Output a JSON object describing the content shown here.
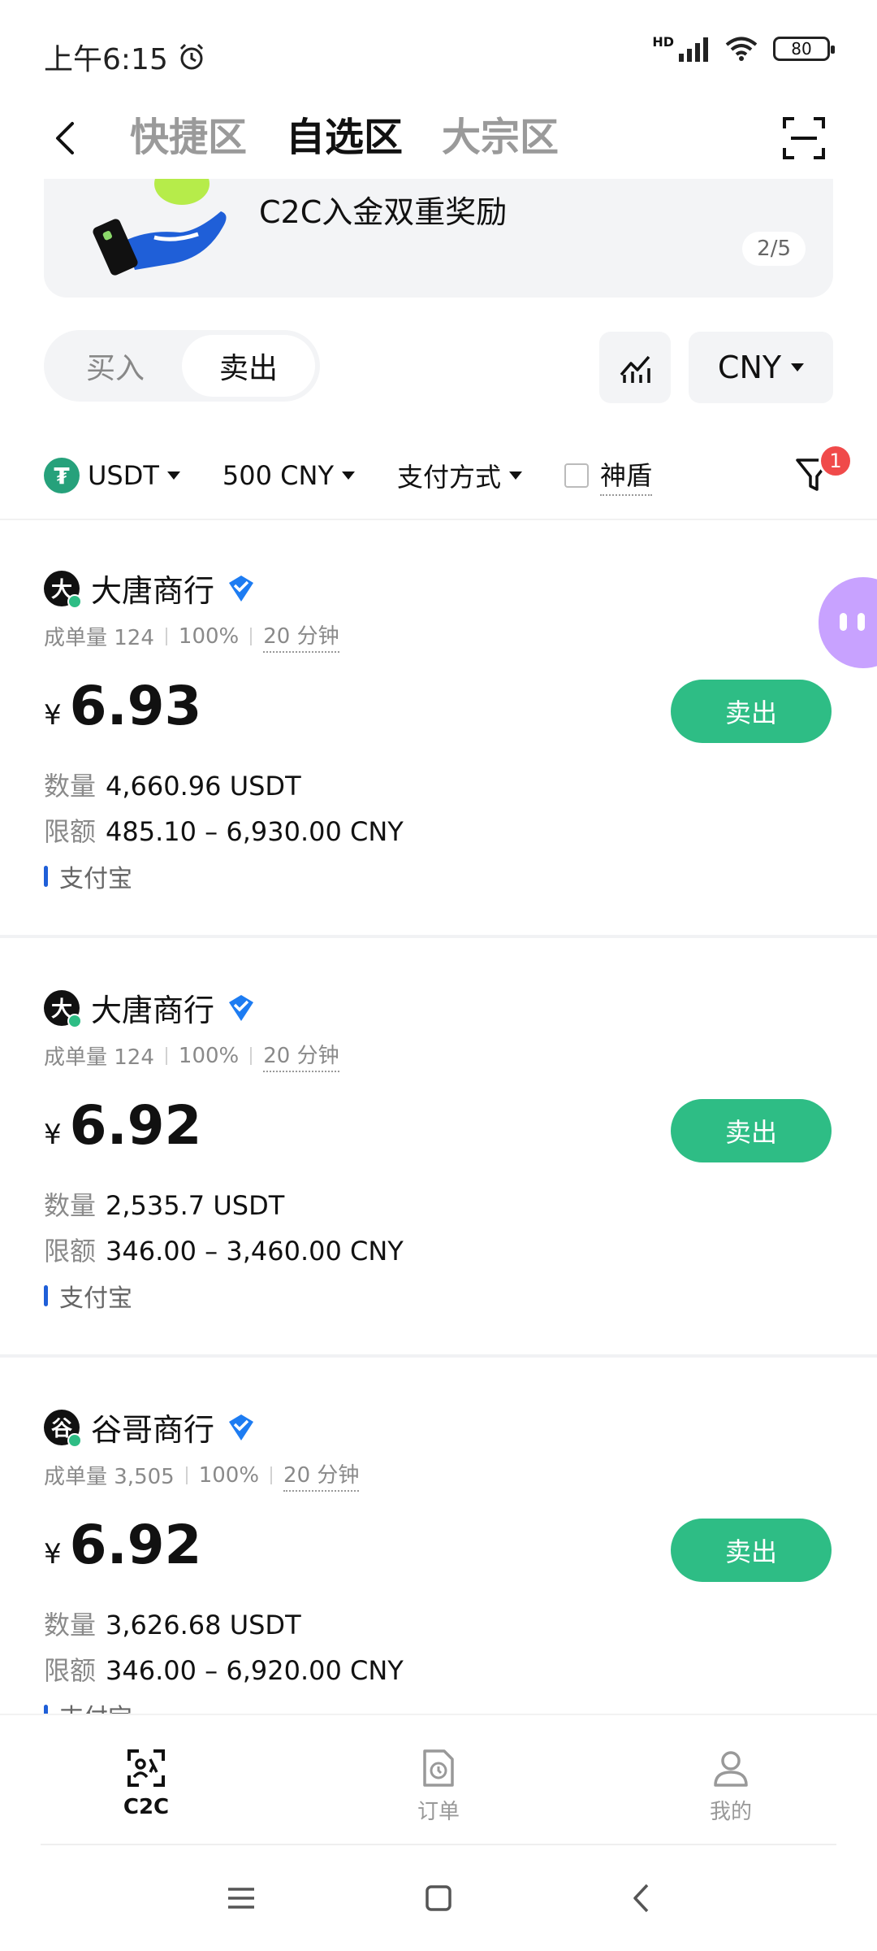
{
  "status_bar": {
    "time": "上午6:15",
    "network": "HD",
    "battery": "80"
  },
  "header": {
    "tabs": [
      {
        "label": "快捷区",
        "active": false
      },
      {
        "label": "自选区",
        "active": true
      },
      {
        "label": "大宗区",
        "active": false
      }
    ]
  },
  "banner": {
    "text": "C2C入金双重奖励",
    "page": "2/5"
  },
  "trade_toggle": {
    "buy_label": "买入",
    "sell_label": "卖出",
    "selected": "卖出"
  },
  "currency": "CNY",
  "filters": {
    "asset": "USDT",
    "amount": "500 CNY",
    "payment": "支付方式",
    "shield": "神盾",
    "badge_count": "1"
  },
  "listings": [
    {
      "avatar": "大",
      "name": "大唐商行",
      "orders": "成单量 124",
      "completion": "100%",
      "time": "20 分钟",
      "currency_symbol": "¥",
      "price": "6.93",
      "quantity_label": "数量",
      "quantity": "4,660.96 USDT",
      "limit_label": "限额",
      "limit": "485.10 – 6,930.00 CNY",
      "payment": "支付宝",
      "action": "卖出"
    },
    {
      "avatar": "大",
      "name": "大唐商行",
      "orders": "成单量 124",
      "completion": "100%",
      "time": "20 分钟",
      "currency_symbol": "¥",
      "price": "6.92",
      "quantity_label": "数量",
      "quantity": "2,535.7 USDT",
      "limit_label": "限额",
      "limit": "346.00 – 3,460.00 CNY",
      "payment": "支付宝",
      "action": "卖出"
    },
    {
      "avatar": "谷",
      "name": "谷哥商行",
      "orders": "成单量 3,505",
      "completion": "100%",
      "time": "20 分钟",
      "currency_symbol": "¥",
      "price": "6.92",
      "quantity_label": "数量",
      "quantity": "3,626.68 USDT",
      "limit_label": "限额",
      "limit": "346.00 – 6,920.00 CNY",
      "payment": "支付宝",
      "action": "卖出"
    }
  ],
  "bottom_nav": [
    {
      "label": "C2C",
      "icon": "c2c-icon",
      "active": true
    },
    {
      "label": "订单",
      "icon": "order-icon",
      "active": false
    },
    {
      "label": "我的",
      "icon": "profile-icon",
      "active": false
    }
  ],
  "colors": {
    "accent_green": "#2ebd85",
    "badge_red": "#f04a4a",
    "verified_blue": "#1d7cf2",
    "tether_green": "#26a17b"
  }
}
